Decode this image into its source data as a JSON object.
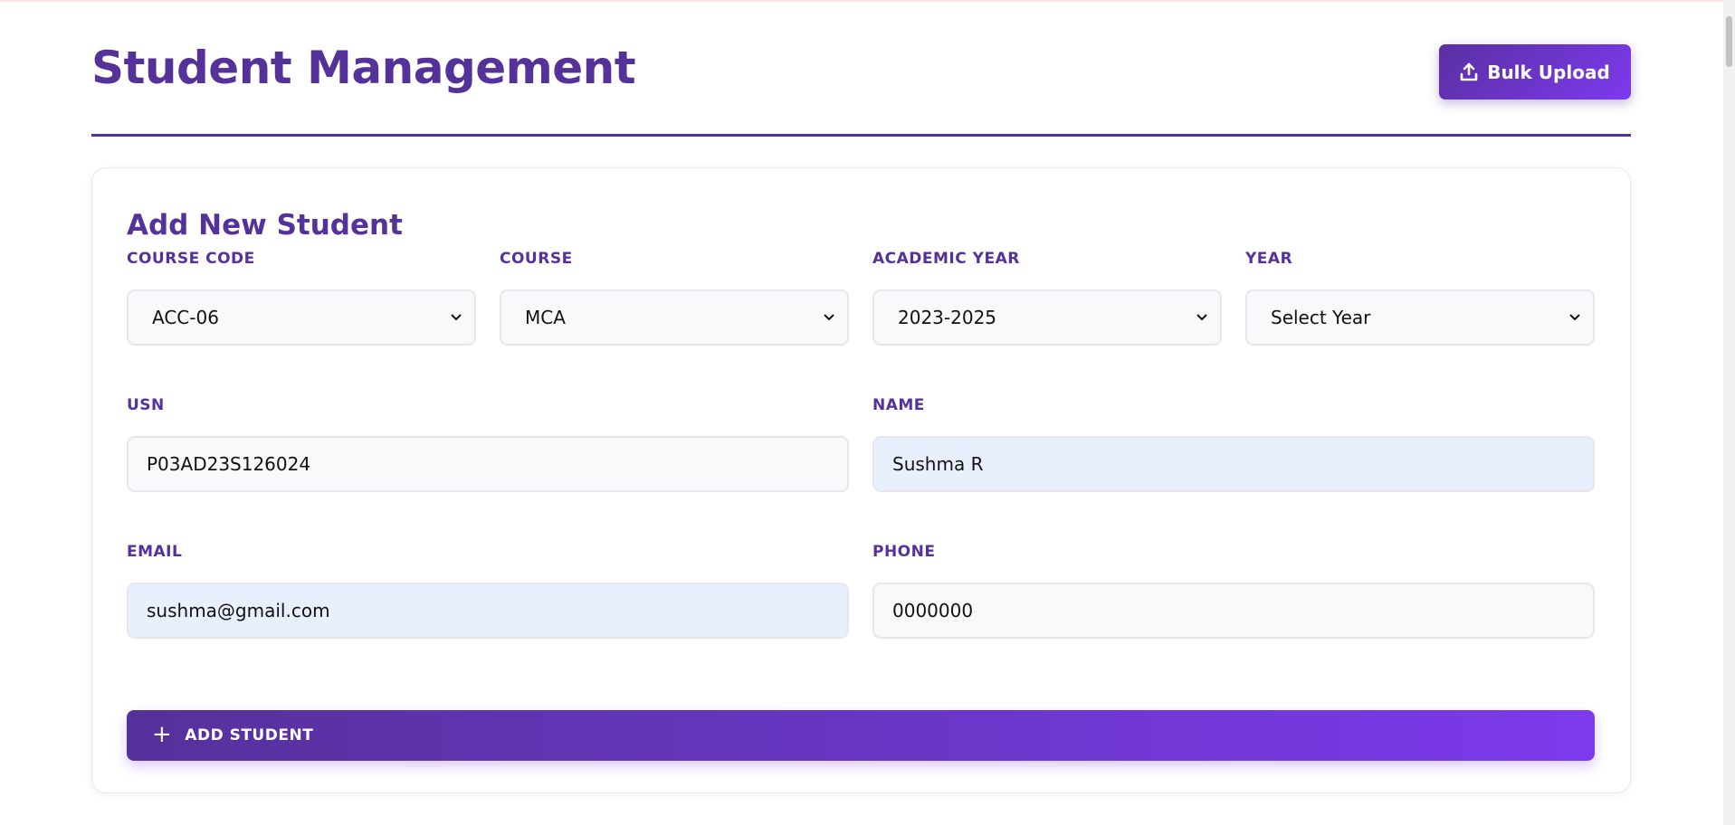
{
  "header": {
    "title": "Student Management",
    "bulk_upload_label": "Bulk Upload"
  },
  "form": {
    "title": "Add New Student",
    "fields": {
      "course_code": {
        "label": "COURSE CODE",
        "value": "ACC-06"
      },
      "course": {
        "label": "COURSE",
        "value": "MCA"
      },
      "academic_year": {
        "label": "ACADEMIC YEAR",
        "value": "2023-2025"
      },
      "year": {
        "label": "YEAR",
        "value": "Select Year"
      },
      "usn": {
        "label": "USN",
        "value": "P03AD23S126024"
      },
      "name": {
        "label": "NAME",
        "value": "Sushma R"
      },
      "email": {
        "label": "EMAIL",
        "value": "sushma@gmail.com"
      },
      "phone": {
        "label": "PHONE",
        "value": "0000000"
      }
    },
    "submit_label": "ADD STUDENT",
    "submit_icon": "+"
  },
  "colors": {
    "brand": "#55319a",
    "accent": "#7c3aed",
    "autofill_bg": "#e8f0fd"
  },
  "icons": {
    "bulk_upload": "upload-icon",
    "submit": "plus-icon",
    "select": "chevron-down-icon"
  }
}
